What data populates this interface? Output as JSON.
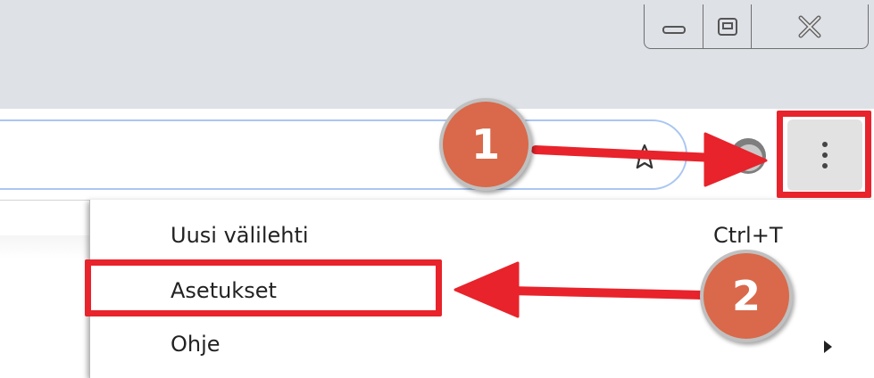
{
  "window_controls": {
    "minimize_icon": "minimize-icon",
    "maximize_icon": "restore-icon",
    "close_icon": "close-icon"
  },
  "toolbar": {
    "bookmark_icon": "star-icon",
    "profile_icon": "avatar-icon",
    "menu_icon": "vertical-dots-icon"
  },
  "menu": {
    "items": [
      {
        "label": "Uusi välilehti",
        "shortcut": "Ctrl+T"
      },
      {
        "label": "Asetukset",
        "shortcut": ""
      },
      {
        "label": "Ohje",
        "shortcut": ""
      }
    ]
  },
  "annotations": {
    "step1": "1",
    "step2": "2",
    "color": "#e8232b",
    "badge_color": "#d9694a"
  }
}
